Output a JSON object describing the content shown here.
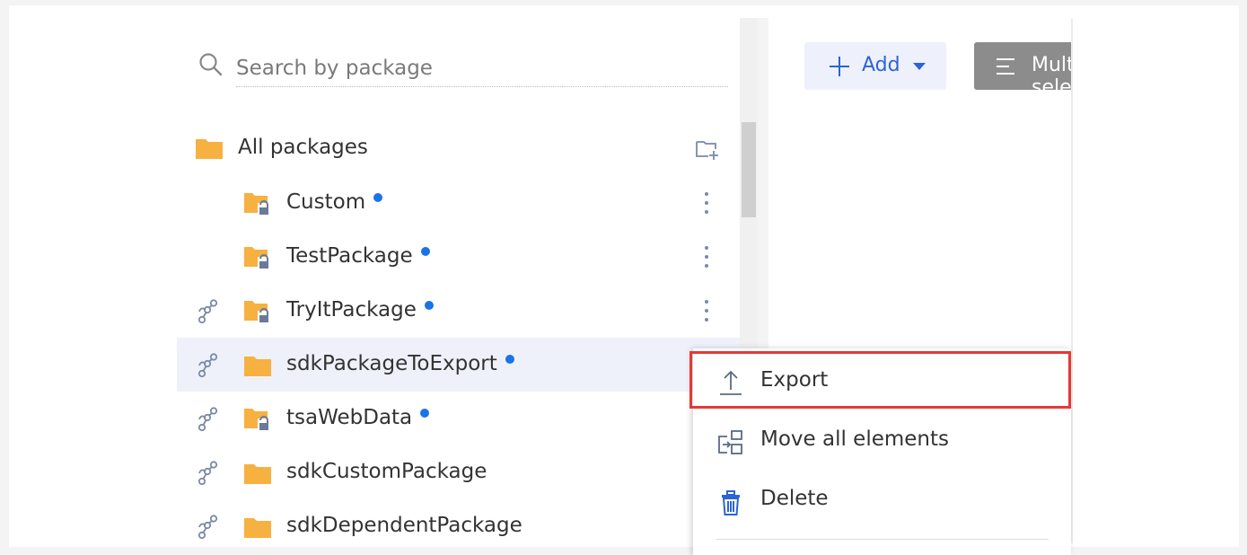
{
  "search": {
    "placeholder": "Search by package"
  },
  "tree": {
    "root": {
      "label": "All packages"
    },
    "items": [
      {
        "label": "Custom",
        "locked": true,
        "linked": false,
        "changed": true
      },
      {
        "label": "TestPackage",
        "locked": true,
        "linked": false,
        "changed": true
      },
      {
        "label": "TryItPackage",
        "locked": true,
        "linked": true,
        "changed": true
      },
      {
        "label": "sdkPackageToExport",
        "locked": false,
        "linked": true,
        "changed": true,
        "selected": true
      },
      {
        "label": "tsaWebData",
        "locked": true,
        "linked": true,
        "changed": true
      },
      {
        "label": "sdkCustomPackage",
        "locked": false,
        "linked": true,
        "changed": false
      },
      {
        "label": "sdkDependentPackage",
        "locked": false,
        "linked": true,
        "changed": false
      }
    ]
  },
  "toolbar": {
    "add_label": "Add",
    "multi_label": "Multiple selection"
  },
  "context_menu": {
    "items": [
      {
        "label": "Export",
        "icon": "export-icon"
      },
      {
        "label": "Move all elements",
        "icon": "move-elements-icon"
      },
      {
        "label": "Delete",
        "icon": "trash-icon"
      }
    ]
  },
  "colors": {
    "folder": "#f6b141",
    "accent_blue": "#1a73e8",
    "add_button_bg": "#eef1fb",
    "add_button_text": "#2b64d6",
    "highlight": "#e53935",
    "selected_row": "#eef1fa"
  }
}
